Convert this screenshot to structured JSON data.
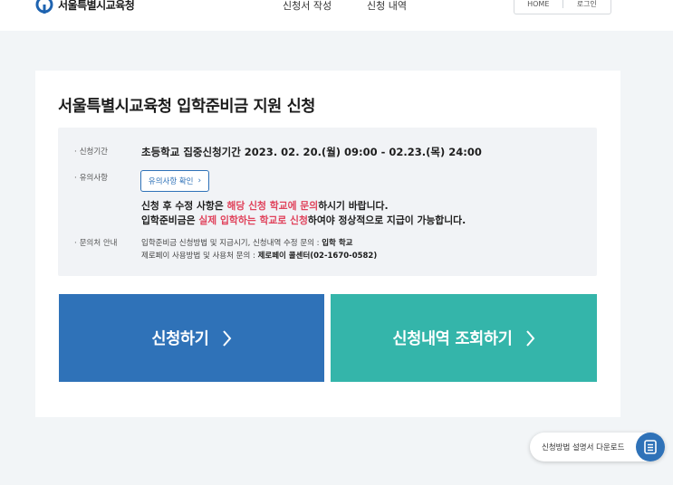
{
  "header": {
    "logo_text": "서울특별시교육청",
    "nav": [
      "신청서 작성",
      "신청 내역"
    ],
    "util": [
      "HOME",
      "로그인"
    ]
  },
  "main": {
    "title": "서울특별시교육청 입학준비금 지원 신청",
    "info": {
      "period_label": "신청기간",
      "period_value": "초등학교 집중신청기간 2023. 02. 20.(월) 09:00 - 02.23.(목) 24:00",
      "notice_label": "유의사항",
      "notice_button": "유의사항 확인",
      "notice_line1": [
        "신청 후 수정 사항은 ",
        "해당 신청 학교에 문의",
        "하시기 바랍니다."
      ],
      "notice_line2": [
        "입학준비금은 ",
        "실제 입학하는 학교로 신청",
        "하여야 정상적으로 지급이 가능합니다."
      ],
      "contact_label": "문의처 안내",
      "contact_line1": [
        "입학준비금 신청방법 및 지급시기, 신청내역 수정 문의 : ",
        "입학 학교"
      ],
      "contact_line2": [
        "제로페이 사용방법 및 사용처 문의 : ",
        "제로페이 콜센터(02-1670-0582)"
      ]
    },
    "buttons": {
      "apply": "신청하기",
      "check": "신청내역 조회하기"
    }
  },
  "floating": {
    "download_label": "신청방법 설명서 다운로드"
  },
  "colors": {
    "primary": "#2f72b8",
    "teal": "#34b5aa",
    "highlight": "#e0425b",
    "background": "#f2f5f7"
  }
}
